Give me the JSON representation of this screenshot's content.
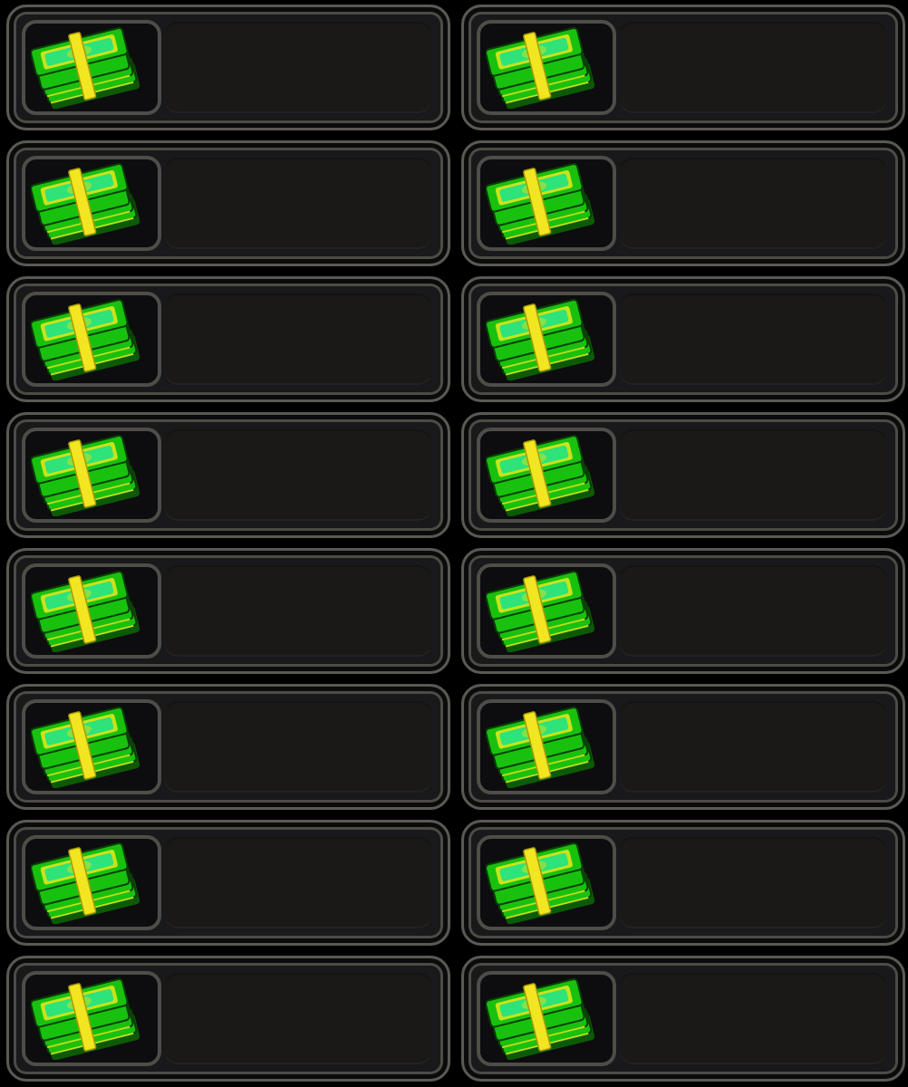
{
  "colors": {
    "background": "#000000",
    "slot_fill": "#19181a",
    "slot_border": "#5b5953",
    "cash_green": "#19c10f",
    "cash_light": "#2de37a",
    "cash_band": "#f2e622"
  },
  "slots": [
    {
      "icon": "cash-stack-icon",
      "value": ""
    },
    {
      "icon": "cash-stack-icon",
      "value": ""
    },
    {
      "icon": "cash-stack-icon",
      "value": ""
    },
    {
      "icon": "cash-stack-icon",
      "value": ""
    },
    {
      "icon": "cash-stack-icon",
      "value": ""
    },
    {
      "icon": "cash-stack-icon",
      "value": ""
    },
    {
      "icon": "cash-stack-icon",
      "value": ""
    },
    {
      "icon": "cash-stack-icon",
      "value": ""
    },
    {
      "icon": "cash-stack-icon",
      "value": ""
    },
    {
      "icon": "cash-stack-icon",
      "value": ""
    },
    {
      "icon": "cash-stack-icon",
      "value": ""
    },
    {
      "icon": "cash-stack-icon",
      "value": ""
    },
    {
      "icon": "cash-stack-icon",
      "value": ""
    },
    {
      "icon": "cash-stack-icon",
      "value": ""
    },
    {
      "icon": "cash-stack-icon",
      "value": ""
    },
    {
      "icon": "cash-stack-icon",
      "value": ""
    }
  ]
}
